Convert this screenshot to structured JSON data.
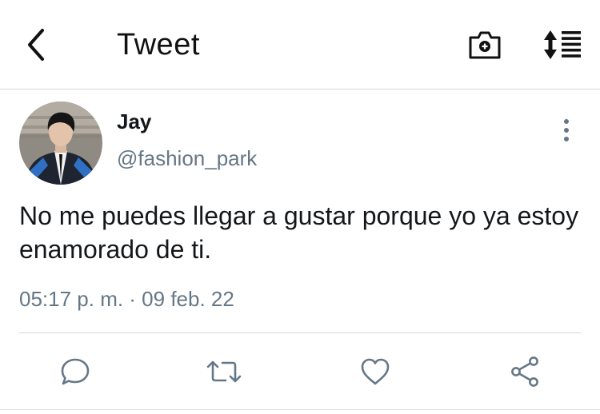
{
  "header": {
    "title": "Tweet",
    "back_icon": "chevron-left-icon",
    "camera_icon": "camera-plus-icon",
    "sort_icon": "sort-list-icon"
  },
  "tweet": {
    "display_name": "Jay",
    "handle": "@fashion_park",
    "text": "No me puedes llegar a gustar porque yo ya estoy enamorado de ti.",
    "timestamp": "05:17 p. m. · 09 feb. 22",
    "more_icon": "more-vertical-icon"
  },
  "actions": [
    {
      "name": "reply",
      "icon": "reply-icon"
    },
    {
      "name": "retweet",
      "icon": "retweet-icon"
    },
    {
      "name": "like",
      "icon": "heart-icon"
    },
    {
      "name": "share",
      "icon": "share-icon"
    }
  ],
  "colors": {
    "text_primary": "#14171a",
    "text_secondary": "#657786",
    "icon": "#657786",
    "divider": "#d6d6d6"
  }
}
